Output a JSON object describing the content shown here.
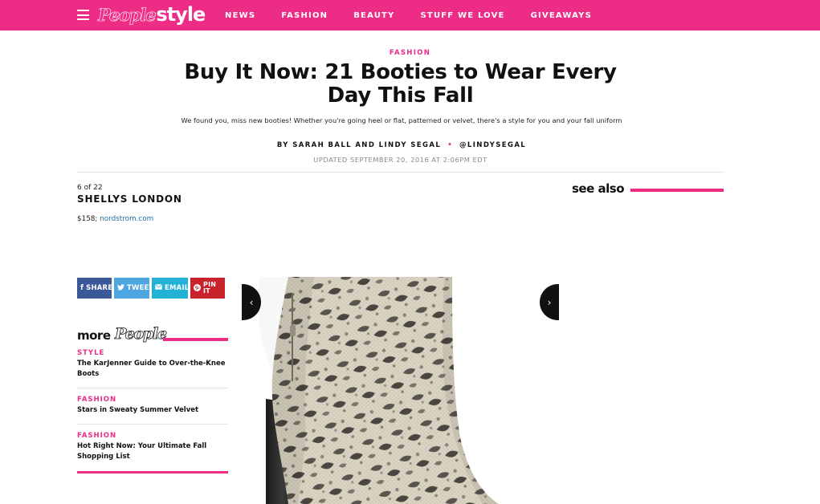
{
  "header": {
    "logo_people": "People",
    "logo_style": "style",
    "nav": [
      "NEWS",
      "FASHION",
      "BEAUTY",
      "STUFF WE LOVE",
      "GIVEAWAYS"
    ]
  },
  "article": {
    "kicker": "FASHION",
    "headline": "Buy It Now: 21 Booties to Wear Every Day This Fall",
    "dek": "We found you, miss new booties! Whether you're going heel or flat, patterned or velvet, there's a style for you and your fall uniform",
    "byline_authors": "BY SARAH BALL AND LINDY SEGAL",
    "byline_dot": "•",
    "byline_handle": "@LINDYSEGAL",
    "updated": "UPDATED SEPTEMBER 20, 2016 AT 2:06PM EDT"
  },
  "slide": {
    "count": "6 of 22",
    "title": "SHELLYS LONDON",
    "price": "$158;",
    "store_link": "nordstrom.com"
  },
  "see_also": {
    "label": "see also"
  },
  "share": {
    "facebook": "SHARE",
    "twitter": "TWEET",
    "email": "EMAIL",
    "pinterest": "PIN IT"
  },
  "more": {
    "label": "more",
    "logo": "People",
    "items": [
      {
        "category": "STYLE",
        "headline": "The KarJenner Guide to Over-the-Knee Boots"
      },
      {
        "category": "FASHION",
        "headline": "Stars in Sweaty Summer Velvet"
      },
      {
        "category": "FASHION",
        "headline": "Hot Right Now: Your Ultimate Fall Shopping List"
      }
    ]
  },
  "gallery": {
    "prev_icon": "chevron-left-icon",
    "next_icon": "chevron-right-icon"
  },
  "colors": {
    "brand_pink": "#ed2c86",
    "facebook": "#3b5998",
    "twitter": "#4ea6e0",
    "email": "#23b2d6",
    "pinterest": "#c8232c",
    "link": "#1a6fa3"
  }
}
